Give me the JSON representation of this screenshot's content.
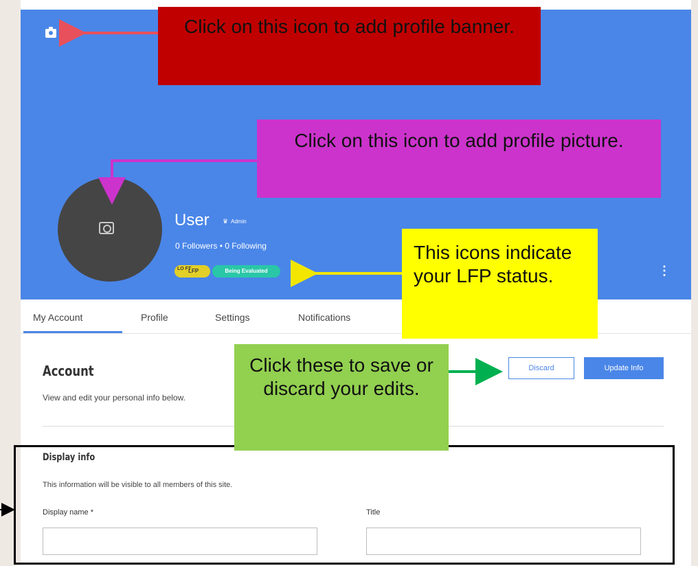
{
  "profile": {
    "name": "User",
    "role": "Admin",
    "follow_stats": "0 Followers • 0 Following",
    "badge_lfp_prefix": "LO FT",
    "badge_lfp": "LFP",
    "badge_status": "Being Evaluated"
  },
  "tabs": [
    "My Account",
    "Profile",
    "Settings",
    "Notifications"
  ],
  "account": {
    "title": "Account",
    "subtitle": "View and edit your personal info below.",
    "discard_label": "Discard",
    "update_label": "Update Info"
  },
  "display_info": {
    "title": "Display info",
    "subtitle": "This information will be visible to all members of this site.",
    "display_name_label": "Display name *",
    "title_label": "Title",
    "display_name_value": "",
    "title_value": ""
  },
  "annotations": {
    "banner": "Click on this icon to add profile banner.",
    "picture": "Click on this icon to add profile picture.",
    "lfp": "This icons indicate your LFP status.",
    "save": "Click these to save or discard your edits."
  },
  "colors": {
    "brand": "#4a86e8",
    "annotation_red": "#c00000",
    "annotation_magenta": "#cc33cc",
    "annotation_yellow": "#ffff00",
    "annotation_green": "#92d050"
  },
  "icons": [
    "camera-icon",
    "crown-icon",
    "more-vertical-icon"
  ]
}
